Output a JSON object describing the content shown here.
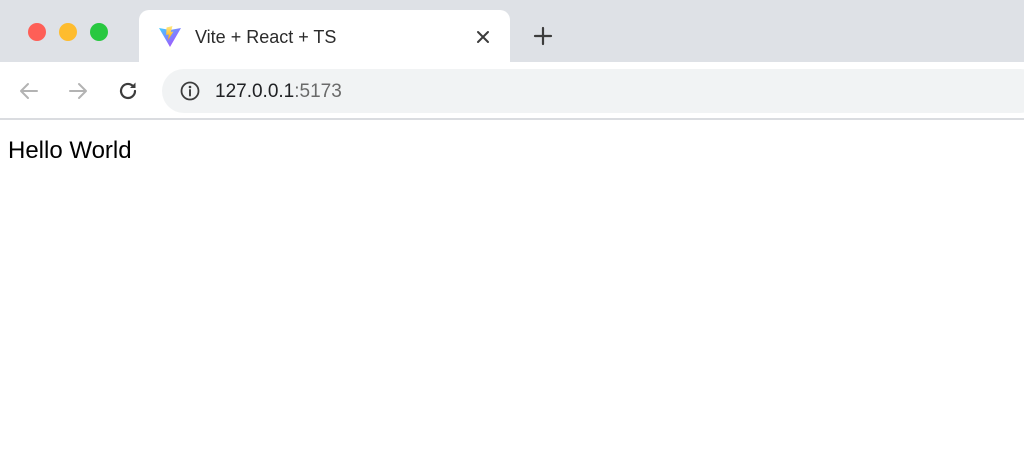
{
  "window": {
    "controls": [
      "close",
      "minimize",
      "maximize"
    ]
  },
  "tab": {
    "title": "Vite + React + TS",
    "favicon": "vite-logo-icon",
    "close_icon": "close-icon"
  },
  "newtab": {
    "icon": "plus-icon"
  },
  "toolbar": {
    "back_icon": "arrow-left-icon",
    "forward_icon": "arrow-right-icon",
    "reload_icon": "reload-icon"
  },
  "omnibox": {
    "icon": "info-icon",
    "host": "127.0.0.1",
    "port": ":5173"
  },
  "page": {
    "text": "Hello World"
  },
  "colors": {
    "tabstrip": "#dee1e6",
    "close": "#fe5f57",
    "minimize": "#febc2e",
    "maximize": "#28c840",
    "omnibox": "#f1f3f4"
  }
}
